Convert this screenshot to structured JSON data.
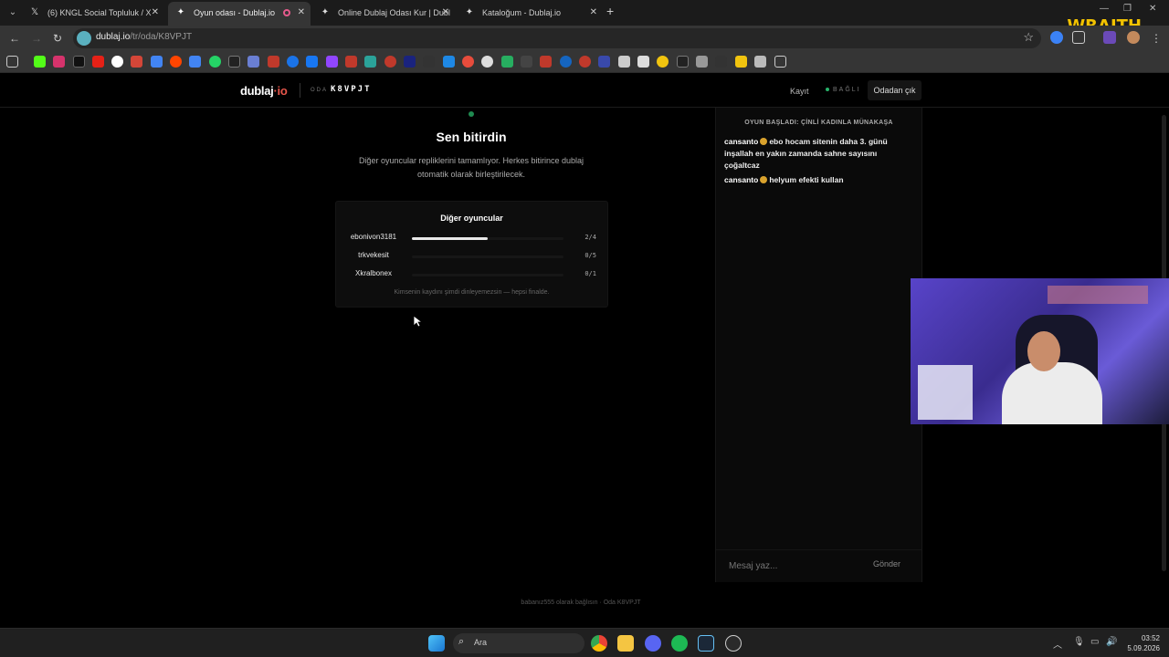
{
  "browser": {
    "tabs": [
      {
        "title": "(6) KNGL Social Topluluk / X",
        "active": false
      },
      {
        "title": "Oyun odası - Dublaj.io",
        "active": true
      },
      {
        "title": "Online Dublaj Odası Kur | Dubl",
        "active": false
      },
      {
        "title": "Kataloğum - Dublaj.io",
        "active": false
      }
    ],
    "url_host": "dublaj.io",
    "url_path": "/tr/oda/K8VPJT",
    "overlay_brand": "WRAITH"
  },
  "site": {
    "logo_main": "dublaj",
    "logo_dot": "·",
    "logo_tld": "io",
    "room_label": "ODA",
    "room_code": "K8VPJT",
    "register_label": "Kayıt",
    "status_label": "BAĞLI",
    "leave_label": "Odadan çık"
  },
  "main": {
    "title": "Sen bitirdin",
    "subtitle": "Diğer oyuncular repliklerini tamamlıyor. Herkes bitirince dublaj otomatik olarak birleştirilecek.",
    "players_title": "Diğer oyuncular",
    "players": [
      {
        "name": "ebonivon3181",
        "progress_label": "2/4",
        "done": 2,
        "total": 4
      },
      {
        "name": "trkvekesit",
        "progress_label": "0/5",
        "done": 0,
        "total": 5
      },
      {
        "name": "Xkralbonex",
        "progress_label": "0/1",
        "done": 0,
        "total": 1
      }
    ],
    "players_note": "Kimsenin kaydını şimdi dinleyemezsin — hepsi finalde."
  },
  "chat": {
    "header": "OYUN BAŞLADI: ÇİNLİ KADINLA MÜNAKAŞA",
    "messages": [
      {
        "user": "cansanto",
        "text": "ebo hocam sitenin daha 3. günü inşallah en yakın zamanda sahne sayısını çoğaltcaz"
      },
      {
        "user": "cansanto",
        "text": "helyum efekti kullan"
      }
    ],
    "input_placeholder": "Mesaj yaz...",
    "send_label": "Gönder"
  },
  "footer": "babanız555 olarak bağlısın · Oda K8VPJT",
  "taskbar": {
    "search_label": "Ara",
    "time": "03:52",
    "date": "5.09.2026"
  }
}
